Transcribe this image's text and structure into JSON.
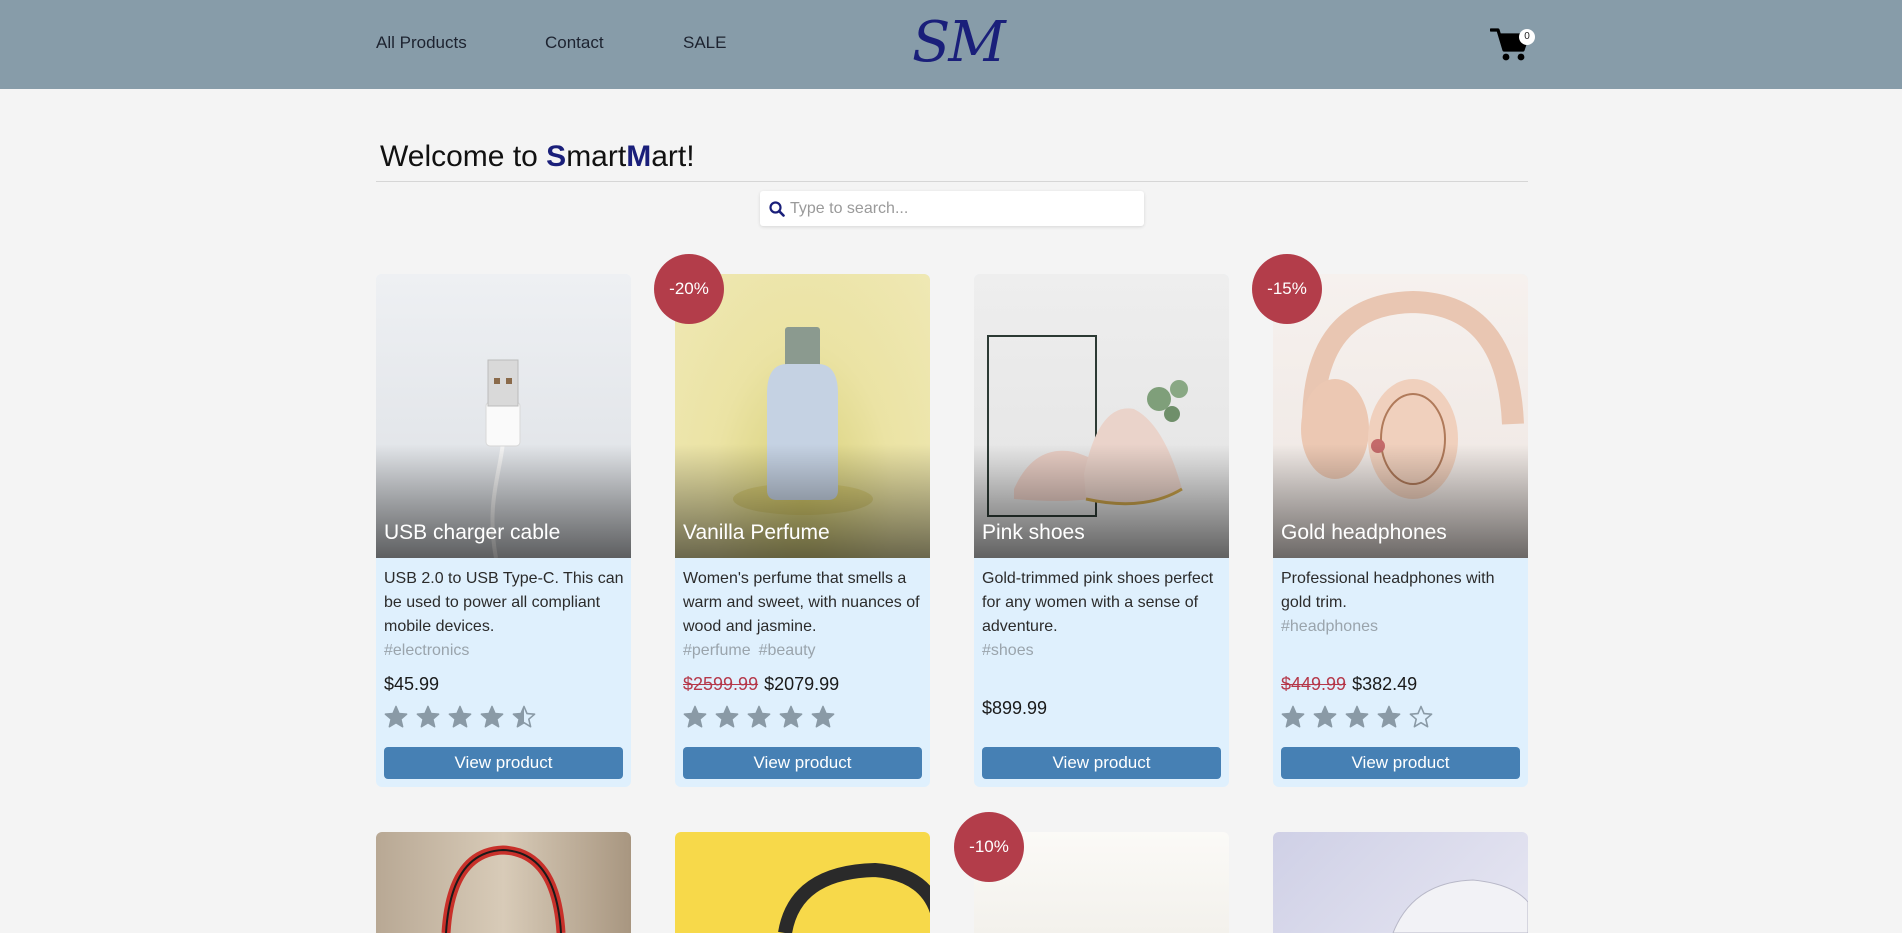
{
  "nav": {
    "links": [
      "All Products",
      "Contact",
      "SALE"
    ],
    "logo": "SM",
    "cart_count": "0"
  },
  "welcome": {
    "prefix": "Welcome to ",
    "s": "S",
    "mart1": "mart",
    "m": "M",
    "mart2": "art!"
  },
  "search": {
    "placeholder": "Type to search..."
  },
  "products": [
    {
      "title": "USB charger cable",
      "description": "USB 2.0 to USB Type-C. This can be used to power all compliant mobile devices.",
      "tags": [
        "#electronics",
        ""
      ],
      "old_price": "",
      "price": "$45.99",
      "rating": 4.5,
      "discount": "",
      "button": "View product"
    },
    {
      "title": "Vanilla Perfume",
      "description": "Women's perfume that smells a warm and sweet, with nuances of wood and jasmine.",
      "tags": [
        "#perfume",
        "#beauty"
      ],
      "old_price": "$2599.99",
      "price": "$2079.99",
      "rating": 5,
      "discount": "-20%",
      "button": "View product"
    },
    {
      "title": "Pink shoes",
      "description": "Gold-trimmed pink shoes perfect for any women with a sense of adventure.",
      "tags": [
        "#shoes",
        ""
      ],
      "old_price": "",
      "price": "$899.99",
      "rating": 0,
      "discount": "",
      "button": "View product"
    },
    {
      "title": "Gold headphones",
      "description": "Professional headphones with gold trim.",
      "tags": [
        "#headphones",
        ""
      ],
      "old_price": "$449.99",
      "price": "$382.49",
      "rating": 4,
      "discount": "-15%",
      "button": "View product"
    }
  ],
  "second_row": {
    "discount": "-10%"
  },
  "colors": {
    "header": "#879ca9",
    "accent": "#1a1f7a",
    "button": "#4680b4",
    "badge": "#b33d4a",
    "card": "#dff0fd",
    "star": "#8a9aa6"
  }
}
